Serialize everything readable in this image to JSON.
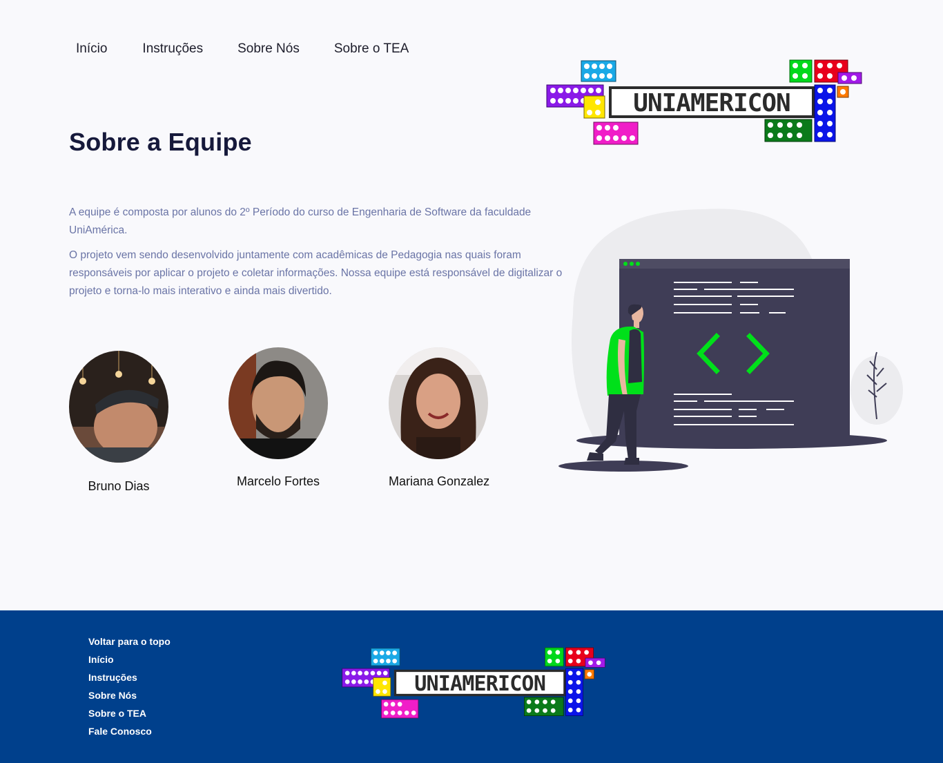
{
  "nav": {
    "items": [
      {
        "label": "Início"
      },
      {
        "label": "Instruções"
      },
      {
        "label": "Sobre Nós"
      },
      {
        "label": "Sobre o TEA"
      }
    ]
  },
  "logo": {
    "text": "UNIAMERICON"
  },
  "main": {
    "title": "Sobre a Equipe",
    "paragraphs": [
      "A equipe é composta por alunos do 2º Período do curso de Engenharia de Software da faculdade UniAmérica.",
      "O projeto vem sendo desenvolvido juntamente com acadêmicas de Pedagogia nas quais foram responsáveis por aplicar o projeto e coletar informações. Nossa equipe está responsável de digitalizar o projeto e torna-lo mais interativo e ainda mais divertido."
    ],
    "members": [
      {
        "name": "Bruno Dias"
      },
      {
        "name": "Marcelo Fortes"
      },
      {
        "name": "Mariana Gonzalez"
      }
    ]
  },
  "footer": {
    "links": [
      {
        "label": "Voltar para o topo"
      },
      {
        "label": "Início"
      },
      {
        "label": "Instruções"
      },
      {
        "label": "Sobre Nós"
      },
      {
        "label": "Sobre o TEA"
      },
      {
        "label": "Fale Conosco"
      }
    ]
  },
  "colors": {
    "footer_bg": "#00408c",
    "title": "#16193b",
    "body_text": "#6a74a6",
    "accent_green": "#00e01a",
    "screen_dark": "#3f3d56"
  }
}
